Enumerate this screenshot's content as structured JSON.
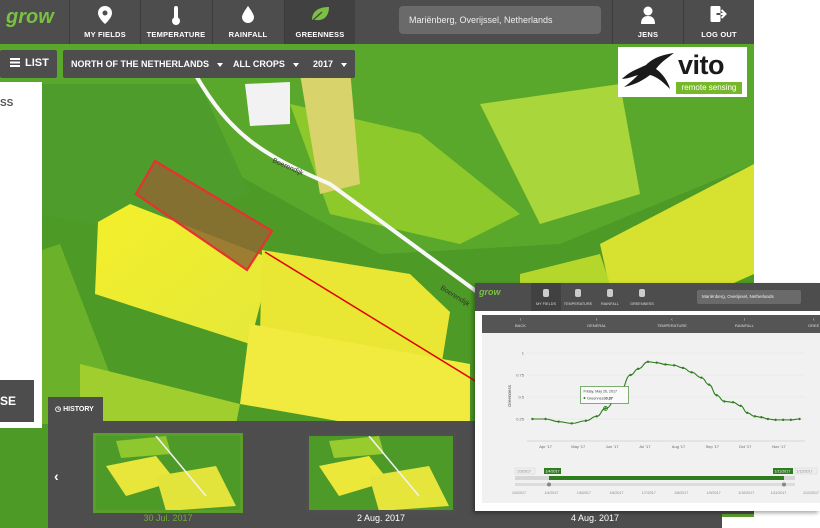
{
  "nav": {
    "items": [
      {
        "label": "MY FIELDS",
        "icon": "map-pin-icon"
      },
      {
        "label": "TEMPERATURE",
        "icon": "thermometer-icon"
      },
      {
        "label": "RAINFALL",
        "icon": "raindrop-icon"
      },
      {
        "label": "GREENNESS",
        "icon": "leaf-icon",
        "active": true
      }
    ],
    "location": "Mariënberg, Overijssel, Netherlands",
    "user_label": "JENS",
    "logout_label": "LOG OUT"
  },
  "toolbar": {
    "list_label": "LIST",
    "region": "NORTH OF THE NETHERLANDS",
    "crops": "ALL CROPS",
    "year": "2017"
  },
  "vito": {
    "word": "vito",
    "subtitle": "remote sensing"
  },
  "map": {
    "road_label": "Boerendijk"
  },
  "left_panel": {
    "text_fragment": "SS",
    "button_fragment": "SE"
  },
  "history": {
    "label": "HISTORY",
    "thumbnails": [
      {
        "date": "30 Jul. 2017",
        "active": true
      },
      {
        "date": "2 Aug. 2017",
        "active": false
      },
      {
        "date": "4 Aug. 2017",
        "active": false
      }
    ]
  },
  "inset": {
    "nav": [
      "MY FIELDS",
      "TEMPERATURE",
      "RAINFALL",
      "GREENNESS"
    ],
    "location": "Mariënberg, Overijssel, Netherlands",
    "tabs": [
      "BACK",
      "GENERAL",
      "TEMPERATURE",
      "RAINFALL",
      "GREE"
    ],
    "tooltip_date": "Friday, May 26, 2017",
    "tooltip_series": "Greenness",
    "tooltip_value": "0.37",
    "range_start": "1/3/2017",
    "range_handle_left": "1/4/2017",
    "range_handle_right": "1/11/2017",
    "range_end": "1/12/2017"
  },
  "chart_data": {
    "type": "line",
    "title": "",
    "xlabel": "",
    "ylabel": "Greenness",
    "ylim": [
      0,
      1
    ],
    "y_ticks": [
      "0.25",
      "0.5",
      "0.75",
      "1"
    ],
    "x_tick_labels": [
      "Apr '17",
      "May '17",
      "Jun '17",
      "Jul '17",
      "Aug '17",
      "Sep '17",
      "Oct '17",
      "Nov '17"
    ],
    "navigator_labels": [
      "1/3/2017",
      "1/4/2017",
      "1/5/2017",
      "1/6/2017",
      "1/7/2017",
      "1/8/2017",
      "1/9/2017",
      "1/10/2017",
      "1/11/2017",
      "1/12/2017"
    ],
    "series": [
      {
        "name": "Greenness",
        "color": "#2e7d1e",
        "points": [
          {
            "x": "2017-03-20",
            "y": 0.25
          },
          {
            "x": "2017-04-01",
            "y": 0.25
          },
          {
            "x": "2017-04-13",
            "y": 0.22
          },
          {
            "x": "2017-04-25",
            "y": 0.2
          },
          {
            "x": "2017-05-08",
            "y": 0.23
          },
          {
            "x": "2017-05-18",
            "y": 0.28
          },
          {
            "x": "2017-05-26",
            "y": 0.37
          },
          {
            "x": "2017-06-08",
            "y": 0.55
          },
          {
            "x": "2017-06-18",
            "y": 0.75
          },
          {
            "x": "2017-06-25",
            "y": 0.82
          },
          {
            "x": "2017-07-04",
            "y": 0.9
          },
          {
            "x": "2017-07-12",
            "y": 0.89
          },
          {
            "x": "2017-07-20",
            "y": 0.87
          },
          {
            "x": "2017-07-28",
            "y": 0.86
          },
          {
            "x": "2017-08-05",
            "y": 0.83
          },
          {
            "x": "2017-08-13",
            "y": 0.78
          },
          {
            "x": "2017-08-22",
            "y": 0.72
          },
          {
            "x": "2017-08-29",
            "y": 0.64
          },
          {
            "x": "2017-09-05",
            "y": 0.52
          },
          {
            "x": "2017-09-12",
            "y": 0.45
          },
          {
            "x": "2017-09-20",
            "y": 0.44
          },
          {
            "x": "2017-09-27",
            "y": 0.4
          },
          {
            "x": "2017-10-03",
            "y": 0.32
          },
          {
            "x": "2017-10-10",
            "y": 0.28
          },
          {
            "x": "2017-10-16",
            "y": 0.27
          },
          {
            "x": "2017-10-22",
            "y": 0.25
          },
          {
            "x": "2017-10-29",
            "y": 0.24
          },
          {
            "x": "2017-11-05",
            "y": 0.24
          },
          {
            "x": "2017-11-12",
            "y": 0.24
          },
          {
            "x": "2017-11-20",
            "y": 0.25
          }
        ]
      }
    ],
    "highlight": {
      "x": "2017-05-26",
      "y": 0.37
    }
  },
  "colors": {
    "nav_bg": "#4d4d4d",
    "brand_green": "#7ac143",
    "field_highlight": "#e8312f",
    "series_green": "#2e7d1e",
    "callout_arrow": "#e00000"
  }
}
